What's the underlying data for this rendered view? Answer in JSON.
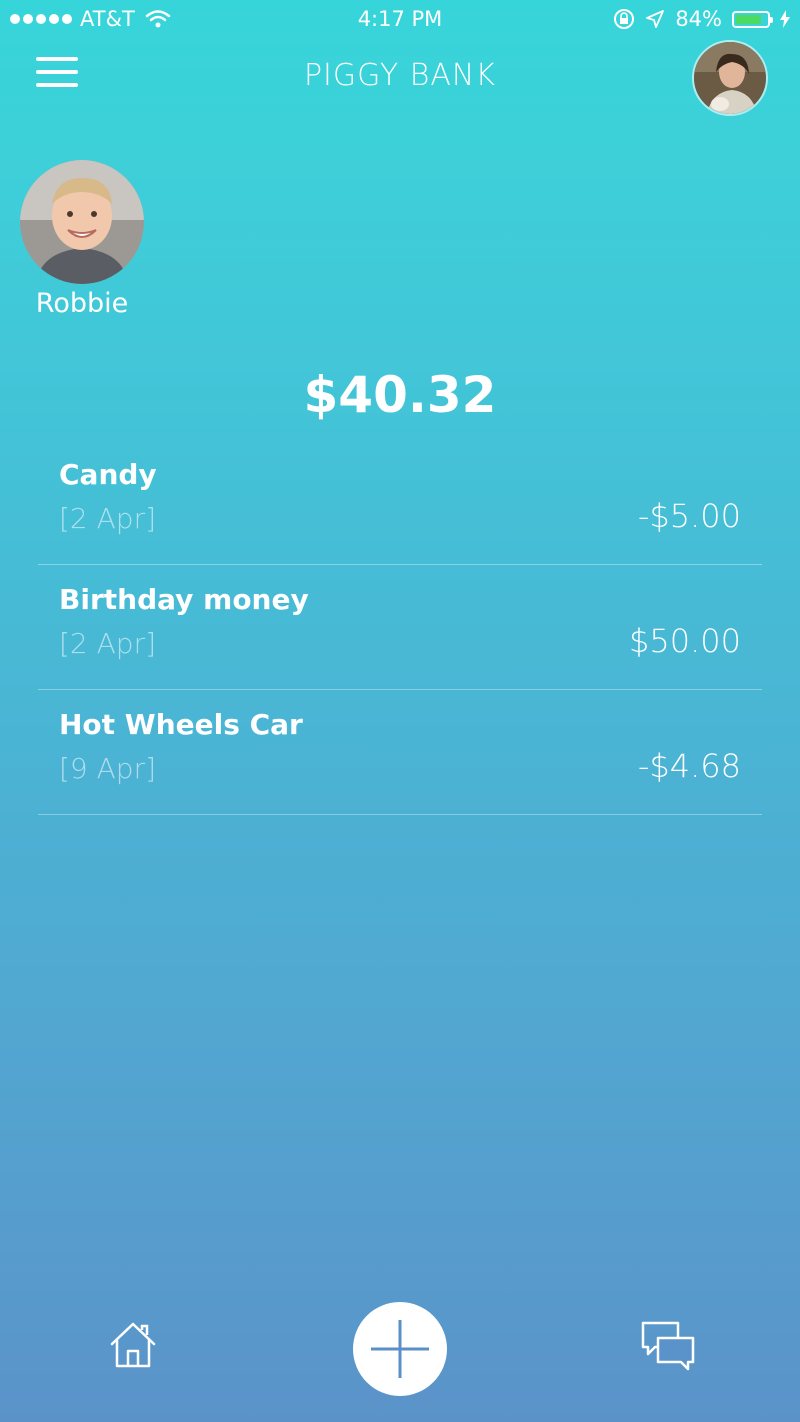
{
  "status_bar": {
    "carrier": "AT&T",
    "time": "4:17 PM",
    "battery_percent": "84%",
    "battery_level": 0.84,
    "battery_color": "#4cd964"
  },
  "nav": {
    "title": "PIGGY BANK",
    "menu_icon": "hamburger-menu-icon",
    "parent_avatar": "parent-avatar"
  },
  "child": {
    "name": "Robbie"
  },
  "balance": "$40.32",
  "transactions": [
    {
      "title": "Candy",
      "date": "[2 Apr]",
      "amount": "-$5.00"
    },
    {
      "title": "Birthday money",
      "date": "[2 Apr]",
      "amount": "$50.00"
    },
    {
      "title": "Hot Wheels Car",
      "date": "[9 Apr]",
      "amount": "-$4.68"
    }
  ],
  "tab_bar": {
    "left_icon": "home-icon",
    "center_icon": "plus-icon",
    "right_icon": "chat-icon"
  },
  "colors": {
    "gradient_top": "#36d5d9",
    "gradient_bottom": "#5b93c9",
    "accent": "#5a8fc7"
  }
}
